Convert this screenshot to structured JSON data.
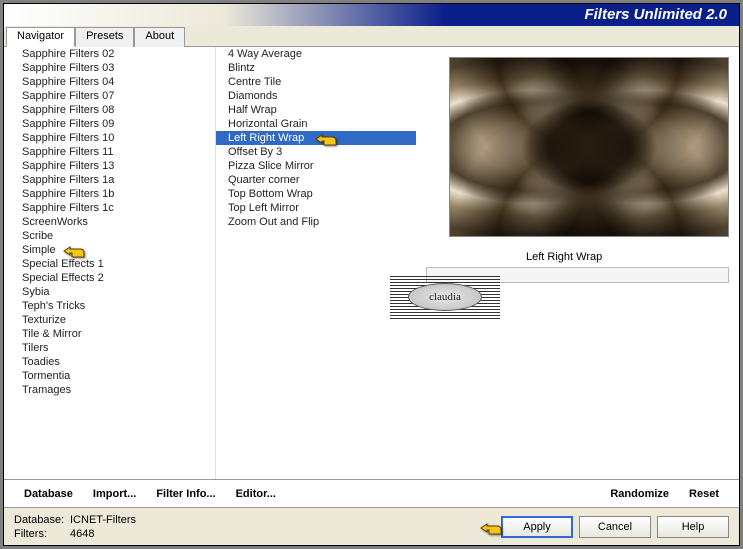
{
  "title": "Filters Unlimited 2.0",
  "tabs": {
    "navigator": "Navigator",
    "presets": "Presets",
    "about": "About"
  },
  "categories": [
    "Sapphire Filters 02",
    "Sapphire Filters 03",
    "Sapphire Filters 04",
    "Sapphire Filters 07",
    "Sapphire Filters 08",
    "Sapphire Filters 09",
    "Sapphire Filters 10",
    "Sapphire Filters 11",
    "Sapphire Filters 13",
    "Sapphire Filters 1a",
    "Sapphire Filters 1b",
    "Sapphire Filters 1c",
    "ScreenWorks",
    "Scribe",
    "Simple",
    "Special Effects 1",
    "Special Effects 2",
    "Sybia",
    "Teph's Tricks",
    "Texturize",
    "Tile & Mirror",
    "Tilers",
    "Toadies",
    "Tormentia",
    "Tramages"
  ],
  "categories_selected": "Simple",
  "filters": [
    "4 Way Average",
    "Blintz",
    "Centre Tile",
    "Diamonds",
    "Half Wrap",
    "Horizontal Grain",
    "Left Right Wrap",
    "Offset By 3",
    "Pizza Slice Mirror",
    "Quarter corner",
    "Top Bottom Wrap",
    "Top Left Mirror",
    "Zoom Out and Flip"
  ],
  "filters_selected": "Left Right Wrap",
  "filter_label": "Left Right Wrap",
  "toolbar": {
    "database": "Database",
    "import": "Import...",
    "filter_info": "Filter Info...",
    "editor": "Editor...",
    "randomize": "Randomize",
    "reset": "Reset"
  },
  "footer": {
    "db_label": "Database:",
    "db_value": "ICNET-Filters",
    "filters_label": "Filters:",
    "filters_value": "4648",
    "apply": "Apply",
    "cancel": "Cancel",
    "help": "Help"
  },
  "watermark": "claudia"
}
